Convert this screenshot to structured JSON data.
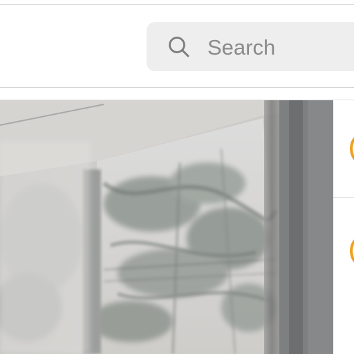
{
  "search": {
    "placeholder": "Search",
    "icon": "search-icon"
  },
  "feed": {
    "post_image": "window-photo",
    "side_items": [
      {
        "avatar": "avatar"
      },
      {
        "avatar": "avatar"
      }
    ]
  },
  "colors": {
    "search_bg": "#eeeeee",
    "placeholder_text": "#8a8a8a",
    "avatar_ring": "#f0a020",
    "divider": "#d4d4d4"
  }
}
